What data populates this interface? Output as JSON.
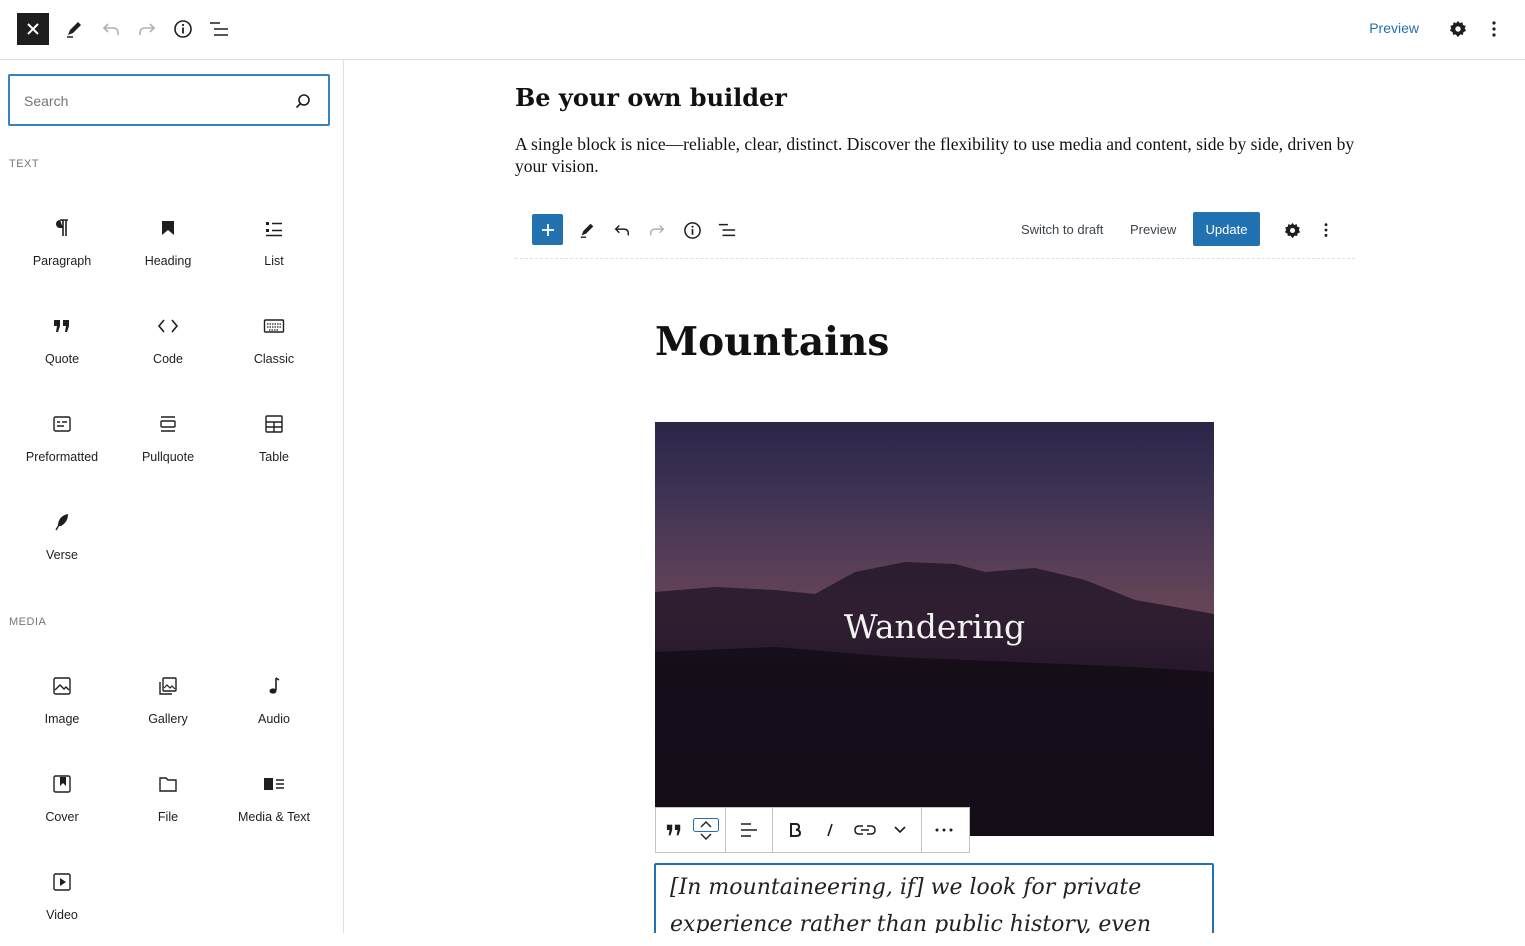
{
  "topbar": {
    "preview_label": "Preview"
  },
  "sidebar": {
    "search": {
      "placeholder": "Search",
      "value": ""
    },
    "categories": [
      {
        "title": "TEXT",
        "items": [
          "Paragraph",
          "Heading",
          "List",
          "Quote",
          "Code",
          "Classic",
          "Preformatted",
          "Pullquote",
          "Table",
          "Verse"
        ]
      },
      {
        "title": "MEDIA",
        "items": [
          "Image",
          "Gallery",
          "Audio",
          "Cover",
          "File",
          "Media & Text",
          "Video"
        ]
      }
    ]
  },
  "canvas": {
    "heading": "Be your own builder",
    "paragraph": "A single block is nice—reliable, clear, distinct. Discover the flexibility to use media and content, side by side, driven by your vision.",
    "inner_editor": {
      "switch_draft": "Switch to draft",
      "preview": "Preview",
      "update": "Update",
      "post_title": "Mountains",
      "cover_text": "Wandering",
      "quote_text": "[In mountaineering, if] we look for private experience rather than public history, even"
    }
  },
  "colors": {
    "accent": "#2271b1",
    "dark": "#1e1e1e"
  }
}
